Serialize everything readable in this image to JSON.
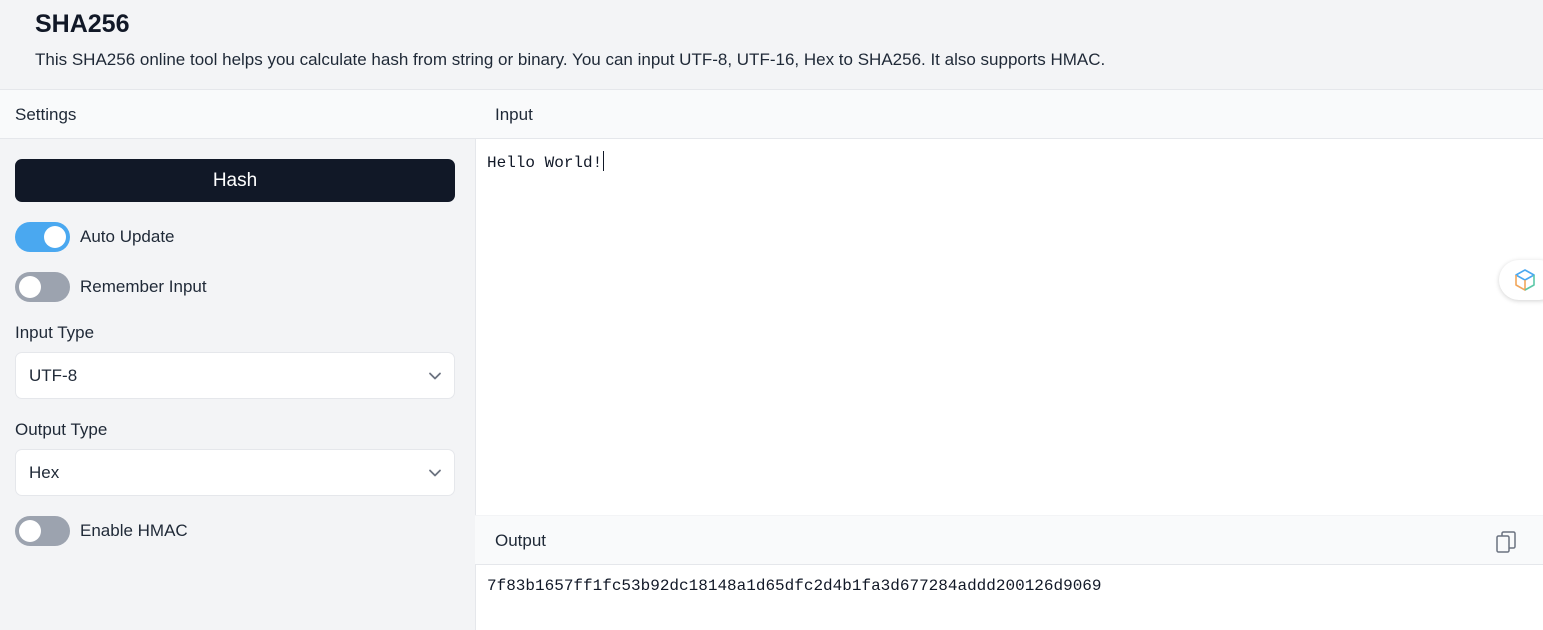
{
  "header": {
    "title": "SHA256",
    "description": "This SHA256 online tool helps you calculate hash from string or binary. You can input UTF-8, UTF-16, Hex to SHA256. It also supports HMAC."
  },
  "settings": {
    "title": "Settings",
    "hash_button": "Hash",
    "auto_update": {
      "label": "Auto Update",
      "on": true
    },
    "remember_input": {
      "label": "Remember Input",
      "on": false
    },
    "input_type": {
      "label": "Input Type",
      "value": "UTF-8"
    },
    "output_type": {
      "label": "Output Type",
      "value": "Hex"
    },
    "enable_hmac": {
      "label": "Enable HMAC",
      "on": false
    }
  },
  "input": {
    "title": "Input",
    "value": "Hello World!"
  },
  "output": {
    "title": "Output",
    "value": "7f83b1657ff1fc53b92dc18148a1d65dfc2d4b1fa3d677284addd200126d9069"
  },
  "icons": {
    "select_arrow": "chevron-down-icon",
    "copy": "copy-icon",
    "floating": "extension-icon"
  },
  "colors": {
    "primary_button": "#111827",
    "toggle_on": "#4aa8f0",
    "toggle_off": "#9ca3af"
  }
}
